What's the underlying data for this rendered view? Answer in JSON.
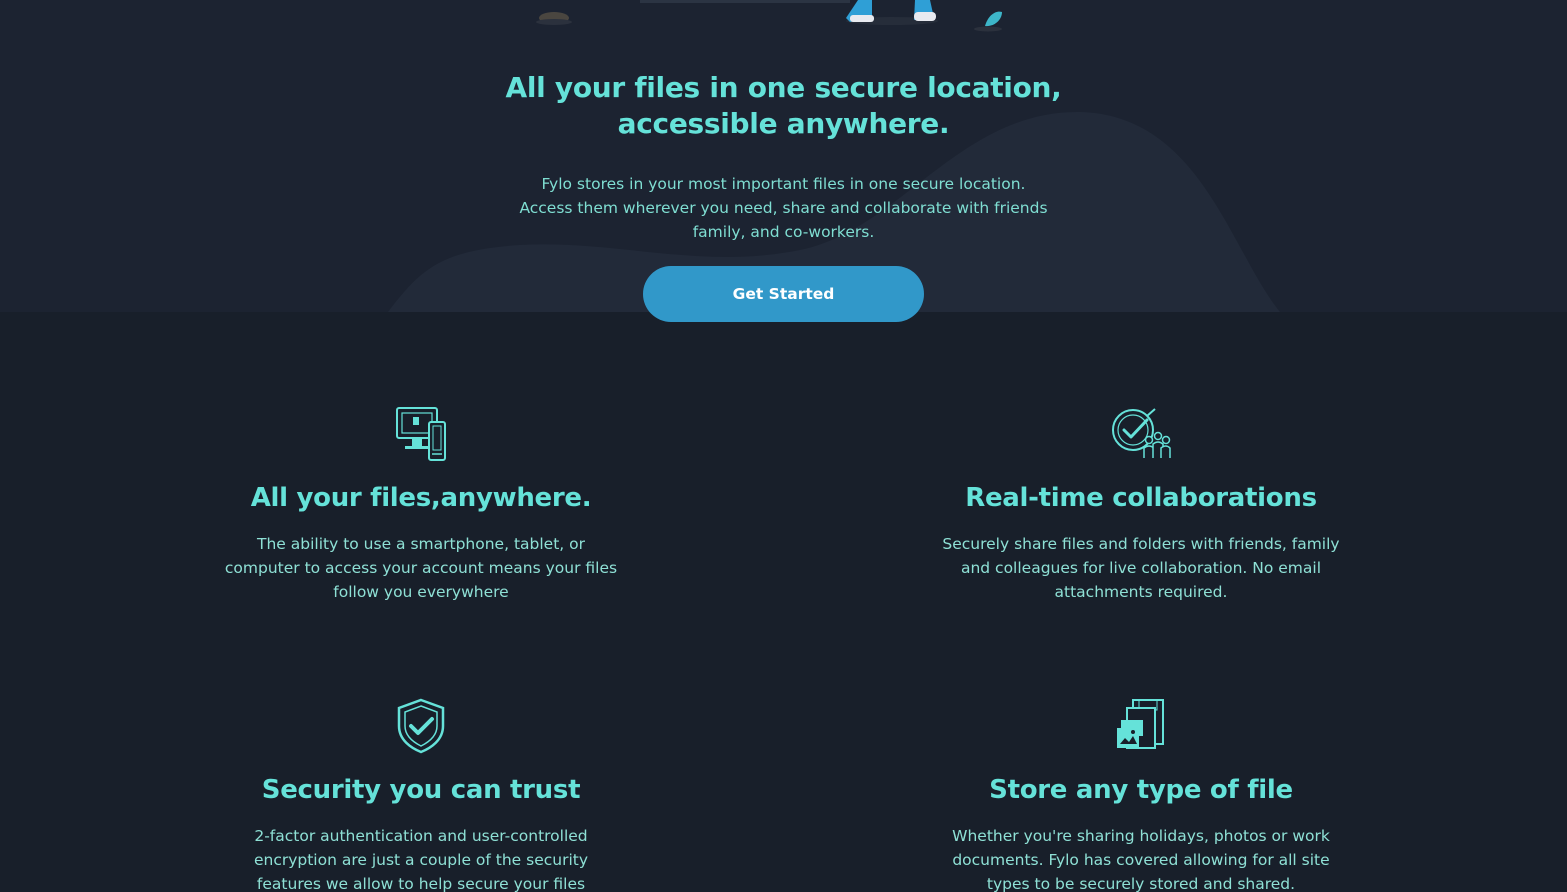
{
  "hero": {
    "title": "All your files in one secure location, accessible anywhere.",
    "description": "Fylo stores in your most important files in one secure location. Access them wherever you need, share and collaborate with friends family, and co-workers.",
    "cta_label": "Get Started"
  },
  "features": [
    {
      "icon": "devices-icon",
      "title": "All your files,anywhere.",
      "text": "The ability to use a smartphone, tablet, or computer to access your account means your files follow you everywhere"
    },
    {
      "icon": "collaboration-icon",
      "title": "Real-time collaborations",
      "text": "Securely share files and folders with friends, family and colleagues for live collaboration. No email attachments required."
    },
    {
      "icon": "shield-check-icon",
      "title": "Security you can trust",
      "text": "2-factor authentication and user-controlled encryption are just a couple of the security features we allow to help secure your files"
    },
    {
      "icon": "file-types-icon",
      "title": "Store any type of file",
      "text": "Whether you're sharing holidays, photos or work documents. Fylo has covered allowing for all site types to be securely stored and shared."
    }
  ],
  "colors": {
    "background": "#181f2a",
    "hero_background": "#1c2331",
    "accent": "#65e2d9",
    "button": "#3198c9"
  }
}
